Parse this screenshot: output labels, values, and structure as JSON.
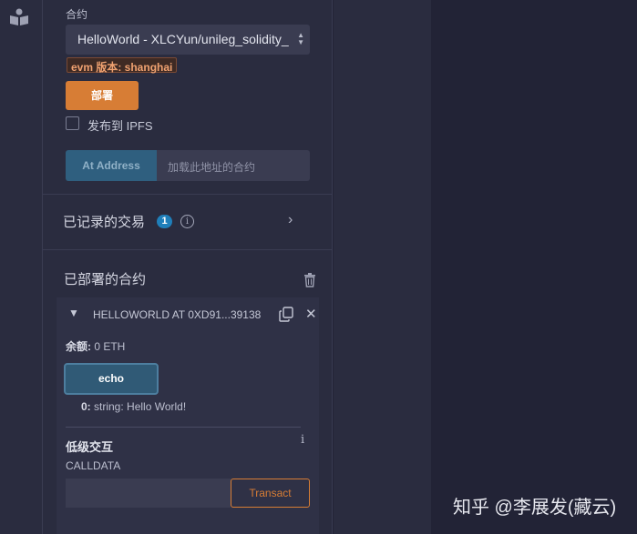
{
  "deploy": {
    "contract_label": "合约",
    "contract_selected": "HelloWorld - XLCYun/unileg_solidity_",
    "evm_badge": "evm 版本: shanghai",
    "deploy_button": "部署",
    "ipfs_label": "发布到 IPFS",
    "at_address_button": "At Address",
    "at_address_placeholder": "加载此地址的合约"
  },
  "transactions": {
    "title": "已记录的交易",
    "count": "1",
    "info": "i"
  },
  "deployed": {
    "title": "已部署的合约",
    "instance": {
      "title": "HELLOWORLD AT 0XD91...39138",
      "balance_label": "余额:",
      "balance_value": "0 ETH",
      "function_button": "echo",
      "output_index": "0:",
      "output_value": "string: Hello World!",
      "low_level_title": "低级交互",
      "calldata_label": "CALLDATA",
      "transact_button": "Transact"
    }
  },
  "watermark": "知乎 @李展发(藏云)",
  "colors": {
    "background": "#222336",
    "panel": "#2a2c3f",
    "accent_orange": "#d77d35",
    "button_blue": "#305a76",
    "badge_blue": "#1f7fba"
  }
}
